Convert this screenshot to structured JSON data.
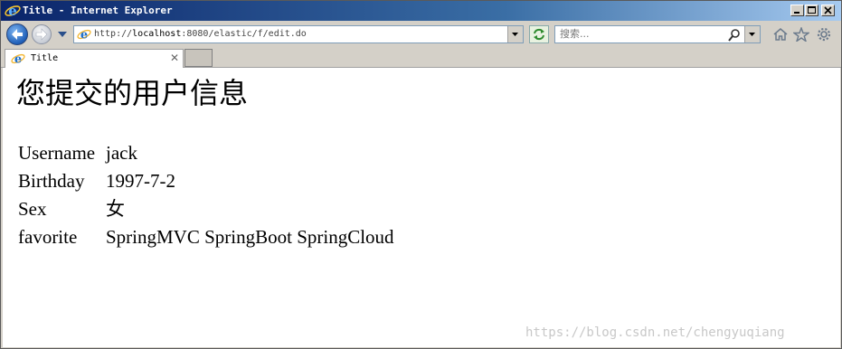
{
  "window": {
    "title": "Title - Internet Explorer",
    "controls": [
      "minimize-icon",
      "maximize-icon",
      "close-icon"
    ]
  },
  "navbar": {
    "url_prefix": "http://",
    "url_host": "localhost",
    "url_rest": ":8080/elastic/f/edit.do",
    "search_placeholder": "搜索..."
  },
  "tabs": [
    {
      "label": "Title"
    }
  ],
  "page": {
    "heading": "您提交的用户信息",
    "rows": [
      {
        "label": "Username",
        "value": "jack"
      },
      {
        "label": "Birthday",
        "value": "1997-7-2"
      },
      {
        "label": "Sex",
        "value": "女"
      },
      {
        "label": "favorite",
        "value": "SpringMVC SpringBoot SpringCloud"
      }
    ]
  },
  "watermark": "https://blog.csdn.net/chengyuqiang",
  "colors": {
    "titlebar_start": "#0a246a",
    "titlebar_end": "#a6caf0",
    "chrome": "#d4d0c8",
    "ie_blue": "#1f6fc9"
  }
}
